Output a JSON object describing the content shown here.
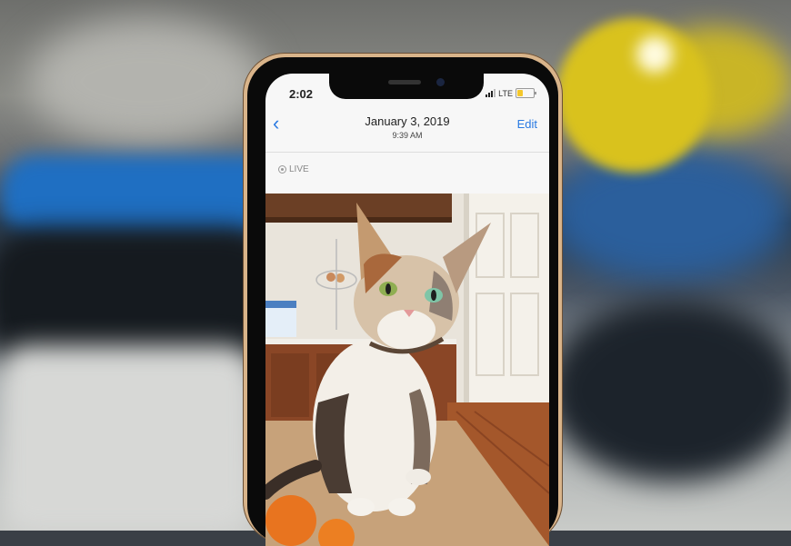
{
  "status_bar": {
    "time": "2:02",
    "network": "LTE",
    "battery_level": 0.3
  },
  "nav_bar": {
    "back_icon": "chevron-left-icon",
    "title": "January 3, 2019",
    "subtitle": "9:39 AM",
    "edit_label": "Edit"
  },
  "live_label": "LIVE",
  "colors": {
    "accent": "#2a7ae2",
    "phone_frame": "#d9b48a",
    "battery_fill": "#f4c72b"
  }
}
